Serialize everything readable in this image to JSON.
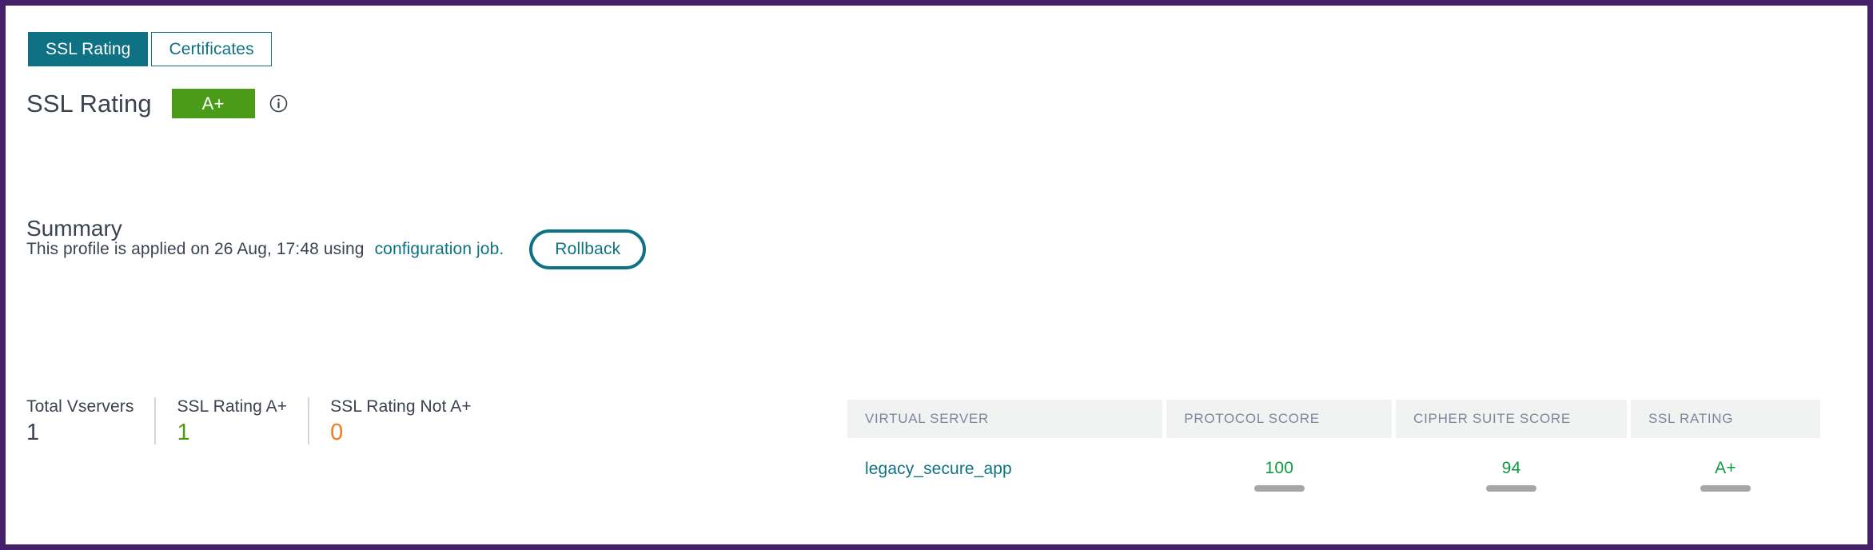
{
  "tabs": [
    {
      "label": "SSL Rating",
      "active": true
    },
    {
      "label": "Certificates",
      "active": false
    }
  ],
  "rating_header": {
    "title": "SSL Rating",
    "badge": "A+",
    "badge_color": "#4a9c18",
    "info_icon": "info-circle-icon"
  },
  "applied": {
    "text": "This profile is applied on 26 Aug, 17:48 using",
    "link": "configuration job.",
    "rollback_label": "Rollback",
    "accent_color": "#0e7284"
  },
  "summary": {
    "title": "Summary",
    "stats": [
      {
        "label": "Total Vservers",
        "value": "1",
        "color": "#3b4250"
      },
      {
        "label": "SSL Rating A+",
        "value": "1",
        "color": "#4a9c18"
      },
      {
        "label": "SSL Rating Not A+",
        "value": "0",
        "color": "#f47b20"
      }
    ]
  },
  "table": {
    "headers": [
      "VIRTUAL SERVER",
      "PROTOCOL SCORE",
      "CIPHER SUITE SCORE",
      "SSL RATING"
    ],
    "rows": [
      {
        "virtual_server": "legacy_secure_app",
        "protocol_score": "100",
        "cipher_suite_score": "94",
        "ssl_rating": "A+"
      }
    ]
  },
  "theme": {
    "frame_color": "#452068",
    "teal": "#0e7284",
    "green": "#0f9b43",
    "orange": "#f47b20"
  }
}
